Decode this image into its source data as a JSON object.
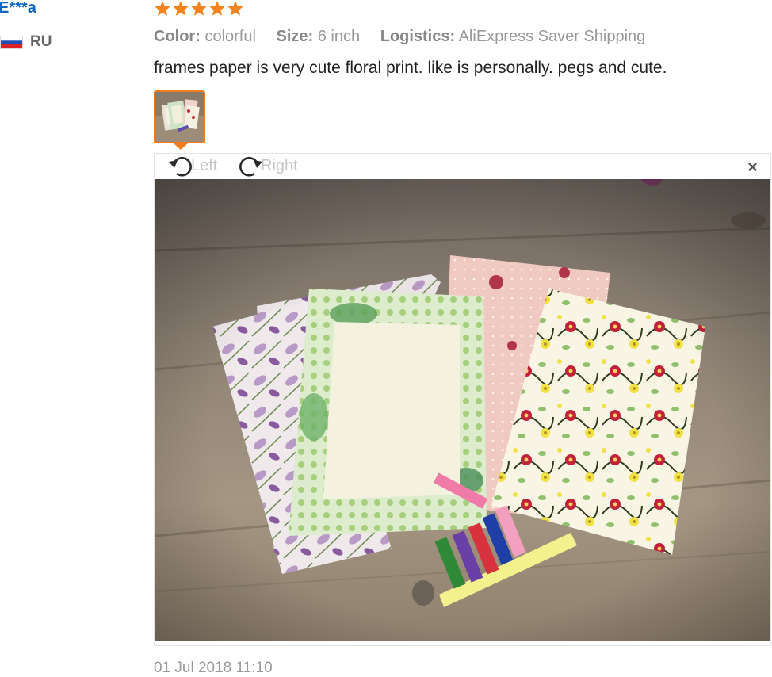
{
  "review": {
    "user_name": "E***a",
    "country_code": "RU",
    "rating": 5,
    "attributes": [
      {
        "label": "Color:",
        "value": "colorful"
      },
      {
        "label": "Size:",
        "value": "6 inch"
      },
      {
        "label": "Logistics:",
        "value": "AliExpress Saver Shipping"
      }
    ],
    "text": "frames paper is very cute floral print. like is personally. pegs and cute.",
    "date": "01 Jul 2018 11:10"
  },
  "viewer": {
    "rotate_left_label": "Left",
    "rotate_right_label": "Right",
    "close_label": "×"
  },
  "colors": {
    "user_link": "#0f66c2",
    "star": "#f5841f",
    "thumb_border": "#f27a1a",
    "muted_text": "#999999"
  },
  "icons": {
    "rating": "star-icon",
    "flag": "russia-flag-icon",
    "rotate_left": "rotate-left-icon",
    "rotate_right": "rotate-right-icon",
    "close": "close-icon"
  }
}
